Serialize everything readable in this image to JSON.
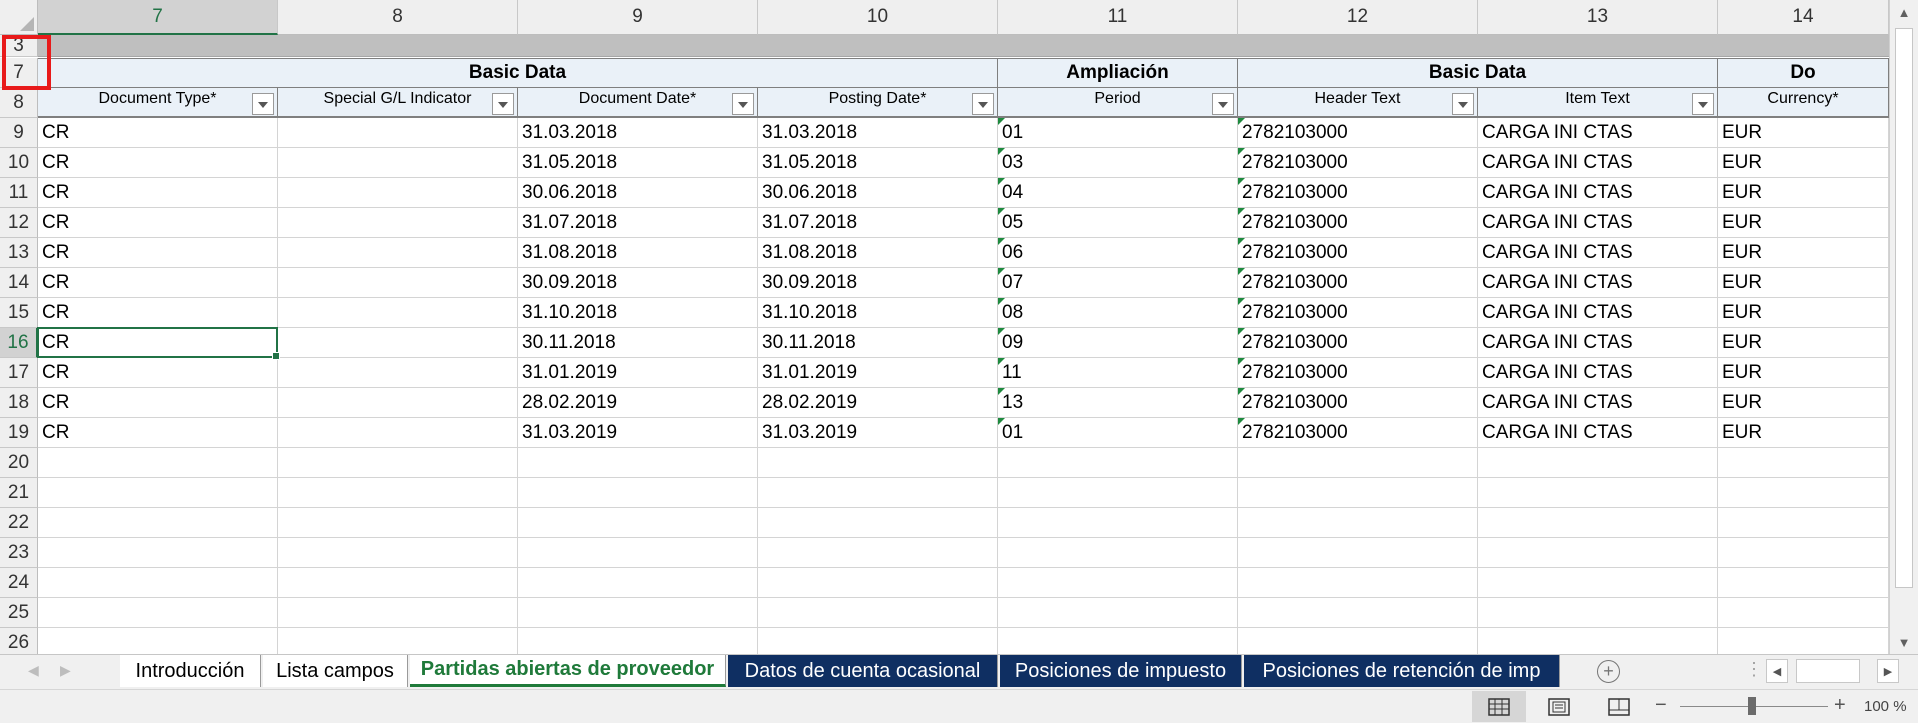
{
  "columns": [
    {
      "label": "7",
      "active": true
    },
    {
      "label": "8"
    },
    {
      "label": "9"
    },
    {
      "label": "10"
    },
    {
      "label": "11"
    },
    {
      "label": "12"
    },
    {
      "label": "13"
    },
    {
      "label": "14"
    }
  ],
  "row_headers": {
    "band": "3",
    "group": "7",
    "fields": "8",
    "data": [
      "9",
      "10",
      "11",
      "12",
      "13",
      "14",
      "15",
      "16",
      "17",
      "18",
      "19",
      "20",
      "21",
      "22",
      "23",
      "24",
      "25",
      "26"
    ],
    "active_row": "16"
  },
  "groups": [
    "Basic Data",
    "Ampliación",
    "Basic Data",
    "Do"
  ],
  "field_headers": [
    "Document Type*",
    "Special G/L Indicator",
    "Document Date*",
    "Posting Date*",
    "Period",
    "Header Text",
    "Item Text",
    "Currency*"
  ],
  "rows": [
    [
      "CR",
      "",
      "31.03.2018",
      "31.03.2018",
      "01",
      "2782103000",
      "CARGA INI CTAS",
      "EUR"
    ],
    [
      "CR",
      "",
      "31.05.2018",
      "31.05.2018",
      "03",
      "2782103000",
      "CARGA INI CTAS",
      "EUR"
    ],
    [
      "CR",
      "",
      "30.06.2018",
      "30.06.2018",
      "04",
      "2782103000",
      "CARGA INI CTAS",
      "EUR"
    ],
    [
      "CR",
      "",
      "31.07.2018",
      "31.07.2018",
      "05",
      "2782103000",
      "CARGA INI CTAS",
      "EUR"
    ],
    [
      "CR",
      "",
      "31.08.2018",
      "31.08.2018",
      "06",
      "2782103000",
      "CARGA INI CTAS",
      "EUR"
    ],
    [
      "CR",
      "",
      "30.09.2018",
      "30.09.2018",
      "07",
      "2782103000",
      "CARGA INI CTAS",
      "EUR"
    ],
    [
      "CR",
      "",
      "31.10.2018",
      "31.10.2018",
      "08",
      "2782103000",
      "CARGA INI CTAS",
      "EUR"
    ],
    [
      "CR",
      "",
      "30.11.2018",
      "30.11.2018",
      "09",
      "2782103000",
      "CARGA INI CTAS",
      "EUR"
    ],
    [
      "CR",
      "",
      "31.01.2019",
      "31.01.2019",
      "11",
      "2782103000",
      "CARGA INI CTAS",
      "EUR"
    ],
    [
      "CR",
      "",
      "28.02.2019",
      "28.02.2019",
      "13",
      "2782103000",
      "CARGA INI CTAS",
      "EUR"
    ],
    [
      "CR",
      "",
      "31.03.2019",
      "31.03.2019",
      "01",
      "2782103000",
      "CARGA INI CTAS",
      "EUR"
    ]
  ],
  "text_indicator_columns": [
    4,
    5
  ],
  "selected_cell": {
    "row": 7,
    "col": 0
  },
  "sheet_tabs": [
    {
      "label": "Introducción",
      "style": "plain"
    },
    {
      "label": "Lista campos",
      "style": "plain"
    },
    {
      "label": "Partidas abiertas de proveedor",
      "style": "active"
    },
    {
      "label": "Datos de cuenta ocasional",
      "style": "navy"
    },
    {
      "label": "Posiciones de impuesto",
      "style": "navy"
    },
    {
      "label": "Posiciones de retención de imp",
      "style": "navy"
    }
  ],
  "status": {
    "zoom": "100 %"
  },
  "colors": {
    "accent": "#217346",
    "tab_navy": "#0f2f62",
    "header_fill": "#eaf1f8",
    "highlight_box": "#e81a1a"
  }
}
